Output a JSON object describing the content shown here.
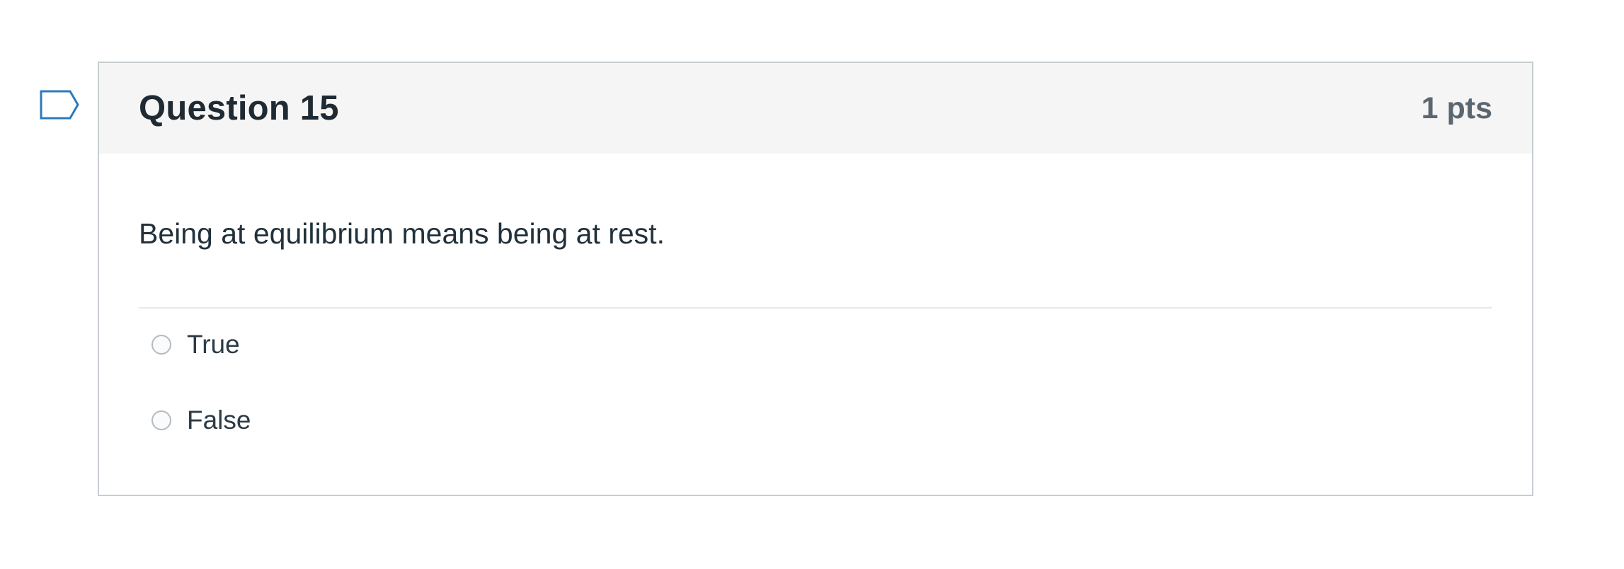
{
  "question": {
    "title": "Question 15",
    "points": "1 pts",
    "text": "Being at equilibrium means being at rest.",
    "flag_icon": "flag-outline-icon",
    "answers": [
      {
        "label": "True",
        "selected": false
      },
      {
        "label": "False",
        "selected": false
      }
    ]
  },
  "colors": {
    "header_bg": "#f5f5f5",
    "border": "#c7cdd1",
    "title_text": "#1f2a33",
    "points_text": "#5b6770",
    "flag_stroke": "#2b7abc"
  }
}
